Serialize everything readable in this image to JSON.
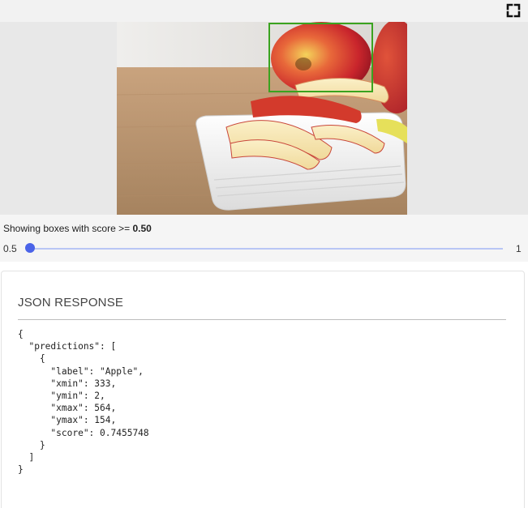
{
  "toolbar": {
    "fullscreen_icon": "fullscreen-icon"
  },
  "detection": {
    "box_color": "#3aa31f",
    "box_label": "Apple"
  },
  "controls": {
    "score_prefix": "Showing boxes with score >=",
    "score_value": "0.50",
    "slider_min": "0.5",
    "slider_max": "1",
    "slider_value": 0.5,
    "accent_color": "#4a63e8"
  },
  "json_panel": {
    "title": "JSON RESPONSE",
    "body": "{\n  \"predictions\": [\n    {\n      \"label\": \"Apple\",\n      \"xmin\": 333,\n      \"ymin\": 2,\n      \"xmax\": 564,\n      \"ymax\": 154,\n      \"score\": 0.7455748\n    }\n  ]\n}"
  }
}
